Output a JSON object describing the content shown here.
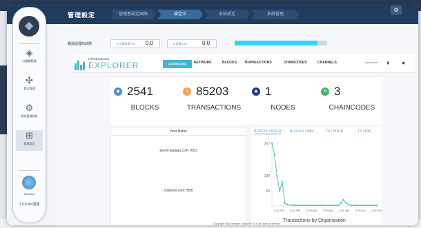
{
  "topbar": {
    "system_title": "管理設定",
    "steps": [
      "管理者設定画面",
      "設定中",
      "系統設定",
      "系統管理"
    ],
    "active_step": 1
  },
  "sidebar": {
    "items": [
      {
        "icon": "layers-icon",
        "label": "分類類管理"
      },
      {
        "icon": "network-icon",
        "label": "節点管理"
      },
      {
        "icon": "gear-icon",
        "label": "設定管理系統"
      },
      {
        "icon": "chip-icon",
        "label": "管理設定"
      }
    ],
    "active_index": 3,
    "user_label": "UB-2024",
    "version_label": "1.0.0 ab\n開発"
  },
  "status_strip": {
    "label": "錯誤處理的狀態",
    "pill_1": {
      "label": "● 交易狀態(Tx)",
      "value": "0.0"
    },
    "pill_2": {
      "label": "● 延遲(Lat)",
      "value": "0.0"
    }
  },
  "navbar": {
    "brand_small": "HYPERLEDGER",
    "brand_big": "EXPLORER",
    "dashboard": "DASHBOARD",
    "links": [
      "NETWORK",
      "BLOCKS",
      "TRANSACTIONS",
      "CHAINCODES",
      "CHANNELS"
    ],
    "channel_select": "mychannel",
    "bell_icon": "bell-icon",
    "user_icon": "user-icon"
  },
  "stats": [
    {
      "value": "2541",
      "label": "BLOCKS",
      "icon": "blocks-icon",
      "color": "#4b8fc1"
    },
    {
      "value": "85203",
      "label": "TRANSACTIONS",
      "icon": "transactions-icon",
      "color": "#f0a550"
    },
    {
      "value": "1",
      "label": "NODES",
      "icon": "nodes-icon",
      "color": "#2a3b8a"
    },
    {
      "value": "3",
      "label": "CHAINCODES",
      "icon": "chaincodes-icon",
      "color": "#4bb36a"
    }
  ],
  "peers": {
    "header": "Peer Name",
    "rows": [
      "peer0.kaaaaa.com:7051",
      "orderer0.com:7050"
    ]
  },
  "chart_tabs": [
    "BLOCKS / HOUR",
    "BLOCKS / MIN",
    "TX / HOUR",
    "TX / MIN"
  ],
  "chart_data": {
    "type": "line",
    "title": "",
    "xlabel": "",
    "ylabel": "",
    "x": [
      "1:00 PM",
      "",
      "",
      "",
      "",
      "",
      "",
      "",
      "",
      "2:00 PM",
      "",
      "3:00 PM",
      "",
      "",
      "",
      "",
      "",
      "",
      "",
      "",
      "1:00 PM",
      "",
      "2:00 AM",
      "",
      "",
      "",
      "",
      "3:00 AM",
      "",
      "",
      "",
      "",
      "",
      "3:00 AM",
      "",
      "",
      "4:00 AM",
      "",
      "",
      "",
      "",
      "5:00 PM"
    ],
    "x_ticks": [
      "2:00 PM",
      "3:00 PM",
      "1:00 AM",
      "2:00 AM",
      "3:00 AM",
      "4:00 AM",
      "5:00 PM"
    ],
    "series": [
      {
        "values": [
          207,
          170,
          100,
          50,
          80,
          10,
          5,
          3,
          2,
          2,
          2,
          2,
          2,
          2,
          2,
          2,
          2,
          2,
          2,
          2,
          2,
          2,
          2,
          2,
          2,
          2,
          2,
          10,
          20,
          10,
          5,
          2,
          2,
          2,
          2,
          2,
          2,
          2,
          2,
          2,
          2,
          2
        ]
      }
    ],
    "y_ticks": [
      "207",
      "100",
      "50"
    ],
    "ylim": [
      0,
      210
    ],
    "grid": false,
    "color": "#5bbfa8"
  },
  "bottom": {
    "caption": "Copyright Hyperledger Explorer v1.1 All rights reserved",
    "title": "Transactions by Organization"
  }
}
